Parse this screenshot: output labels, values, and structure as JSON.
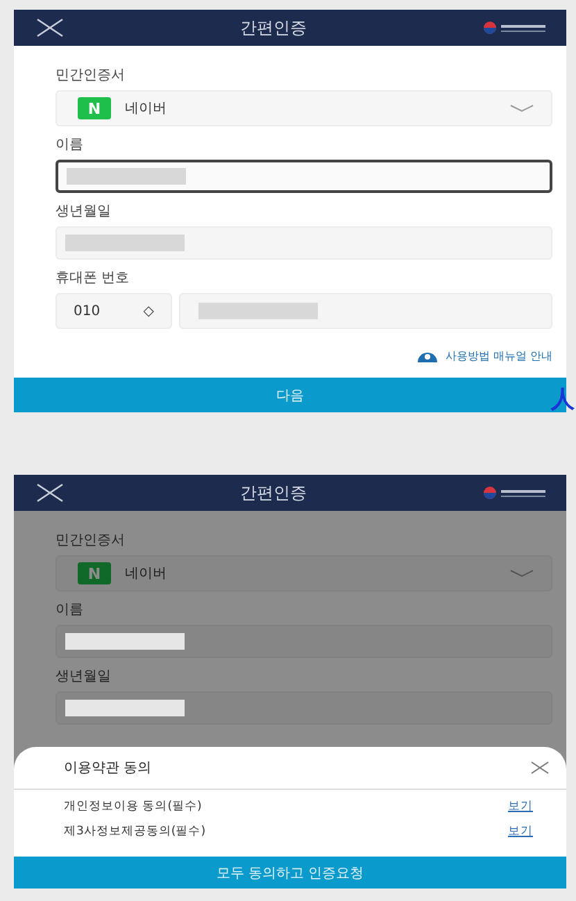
{
  "screens": [
    {
      "dimmed": false,
      "header": {
        "title": "간편인증"
      },
      "fields": [
        {
          "kind": "select",
          "label": "민간인증서",
          "badge": "N",
          "value": "네이버"
        },
        {
          "kind": "input",
          "label": "이름",
          "focused": true
        },
        {
          "kind": "input",
          "label": "생년월일",
          "focused": false
        },
        {
          "kind": "phone",
          "label": "휴대폰 번호",
          "prefix": "010",
          "spinner": "◇"
        }
      ],
      "manual_link": "사용방법 매뉴얼 안내",
      "next_button": "다음"
    },
    {
      "dimmed": true,
      "header": {
        "title": "간편인증"
      },
      "fields": [
        {
          "kind": "select",
          "label": "민간인증서",
          "badge": "N",
          "value": "네이버"
        },
        {
          "kind": "input",
          "label": "이름",
          "focused": false
        },
        {
          "kind": "input",
          "label": "생년월일",
          "focused": false
        }
      ],
      "sheet": {
        "title": "이용약관 동의",
        "items": [
          {
            "label": "개인정보이용 동의(필수)",
            "link": "보기"
          },
          {
            "label": "제3사정보제공동의(필수)",
            "link": "보기"
          }
        ],
        "button": "모두 동의하고 인증요청"
      }
    }
  ],
  "side_mark": "人"
}
